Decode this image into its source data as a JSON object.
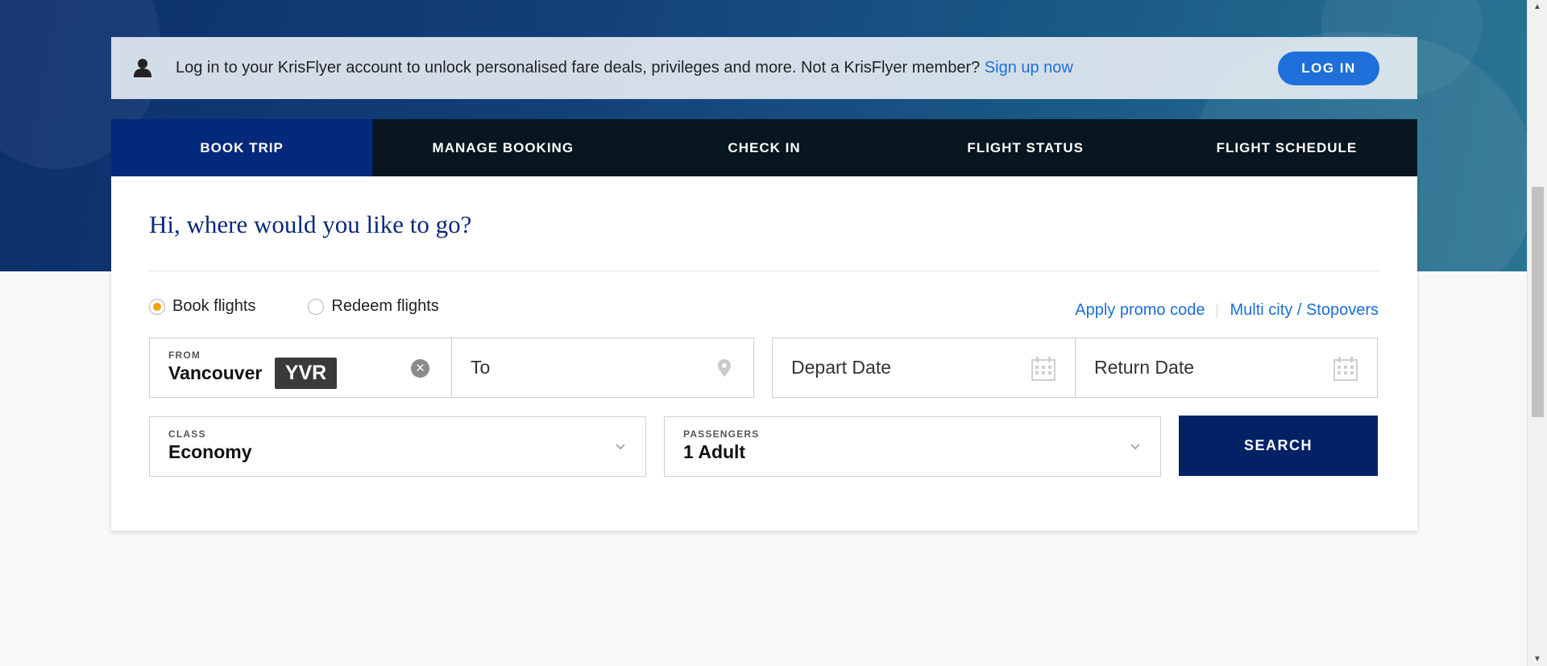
{
  "banner": {
    "message": "Log in to your KrisFlyer account to unlock personalised fare deals, privileges and more. Not a KrisFlyer member?",
    "signup_link": "Sign up now",
    "login_button": "LOG IN"
  },
  "tabs": [
    {
      "label": "BOOK TRIP",
      "active": true
    },
    {
      "label": "MANAGE BOOKING",
      "active": false
    },
    {
      "label": "CHECK IN",
      "active": false
    },
    {
      "label": "FLIGHT STATUS",
      "active": false
    },
    {
      "label": "FLIGHT SCHEDULE",
      "active": false
    }
  ],
  "form": {
    "heading": "Hi, where would you like to go?",
    "radio_options": [
      {
        "label": "Book flights",
        "checked": true
      },
      {
        "label": "Redeem flights",
        "checked": false
      }
    ],
    "links": {
      "promo": "Apply promo code",
      "multicity": "Multi city / Stopovers"
    },
    "from": {
      "label": "FROM",
      "city": "Vancouver",
      "code": "YVR"
    },
    "to": {
      "placeholder": "To"
    },
    "depart": {
      "placeholder": "Depart Date"
    },
    "return": {
      "placeholder": "Return Date"
    },
    "class": {
      "label": "CLASS",
      "value": "Economy"
    },
    "passengers": {
      "label": "PASSENGERS",
      "value": "1 Adult"
    },
    "search_button": "SEARCH"
  },
  "colors": {
    "brand_navy": "#032266",
    "active_tab": "#032a7a",
    "link": "#1c6fd6",
    "radio_selected": "#f5a00b"
  }
}
